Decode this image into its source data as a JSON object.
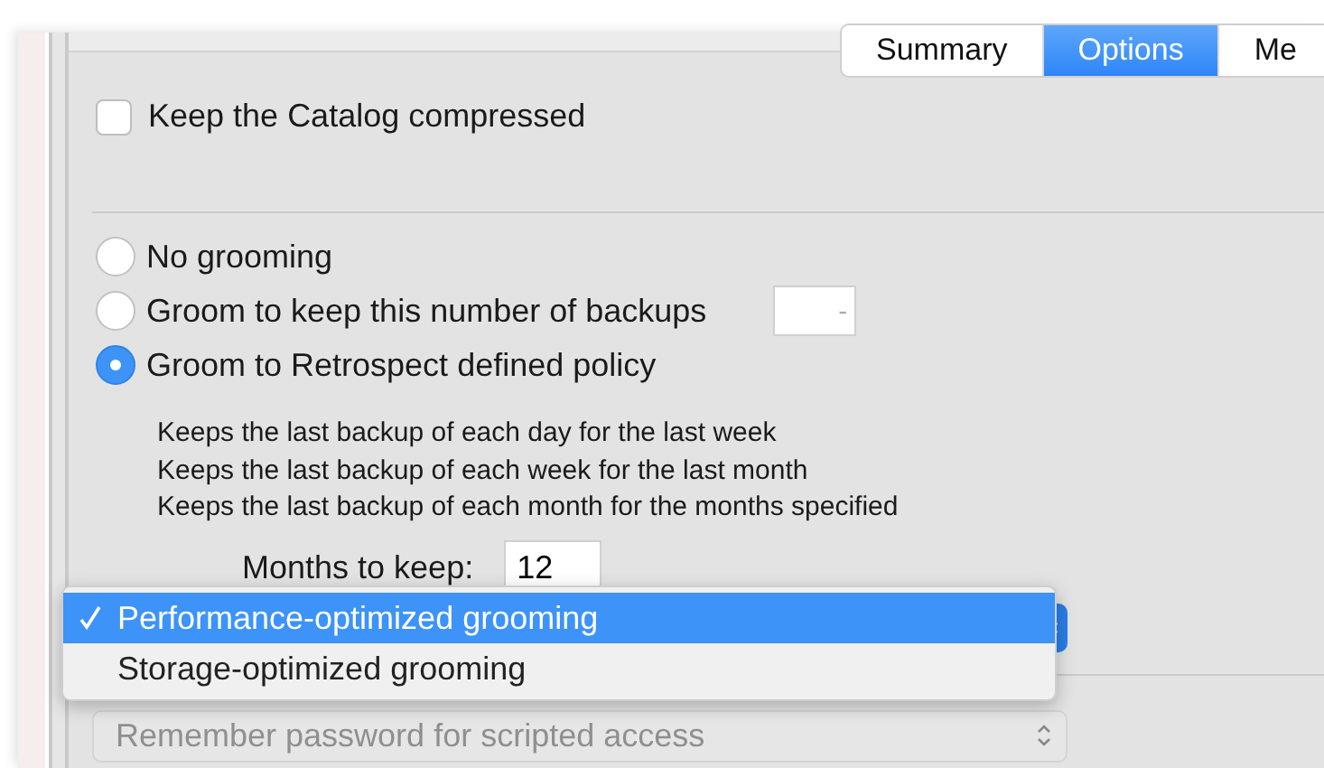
{
  "tabs": [
    {
      "label": "Summary",
      "selected": false
    },
    {
      "label": "Options",
      "selected": true
    },
    {
      "label": "Me",
      "selected": false
    }
  ],
  "catalog_checkbox": {
    "label": "Keep the Catalog compressed",
    "checked": false
  },
  "grooming": {
    "options": [
      {
        "label": "No grooming",
        "selected": false
      },
      {
        "label": "Groom to keep this number of backups",
        "selected": false
      },
      {
        "label": "Groom to Retrospect defined policy",
        "selected": true
      }
    ],
    "backups_field": {
      "placeholder": "-"
    },
    "policy_lines": [
      "Keeps the last backup of each day for the last week",
      "Keeps the last backup of each week for the last month",
      "Keeps the last backup of each month for the months specified"
    ],
    "months": {
      "label": "Months to keep:",
      "value": "12"
    }
  },
  "grooming_menu": {
    "items": [
      {
        "label": "Performance-optimized grooming",
        "selected": true
      },
      {
        "label": "Storage-optimized grooming",
        "selected": false
      }
    ]
  },
  "password_popup": {
    "label": "Remember password for scripted access",
    "disabled": true
  }
}
